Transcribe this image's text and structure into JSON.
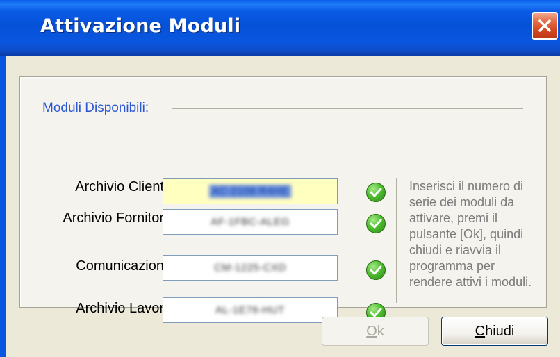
{
  "window": {
    "title": "Attivazione Moduli",
    "close_icon": "close-icon"
  },
  "group": {
    "label": "Moduli Disponibili:"
  },
  "fields": [
    {
      "label": "Archivio Clienti:",
      "value": "AC-2108-R4HE",
      "status_icon": "check-icon",
      "active": true
    },
    {
      "label": "Archivio Fornitori:",
      "value": "AF-1FBC-ALEG",
      "status_icon": "check-icon",
      "active": false
    },
    {
      "label": "Comunicazioni:",
      "value": "CM-1225-CXD",
      "status_icon": "check-icon",
      "active": false
    },
    {
      "label": "Archivio Lavori:",
      "value": "AL-1E76-HUT",
      "status_icon": "check-icon",
      "active": false
    }
  ],
  "help": {
    "text": "Inserisci il numero di serie dei moduli da attivare, premi il pulsante [Ok], quindi chiudi e riavvia il programma per rendere attivi i moduli."
  },
  "buttons": {
    "ok_mnemonic": "O",
    "ok_rest": "k",
    "ok_enabled": false,
    "close_mnemonic": "C",
    "close_rest": "hiudi"
  },
  "colors": {
    "titlebar": "#0552d8",
    "group_label": "#2b57d6",
    "active_field": "#ffffc0",
    "check_green": "#4fbf2e"
  }
}
